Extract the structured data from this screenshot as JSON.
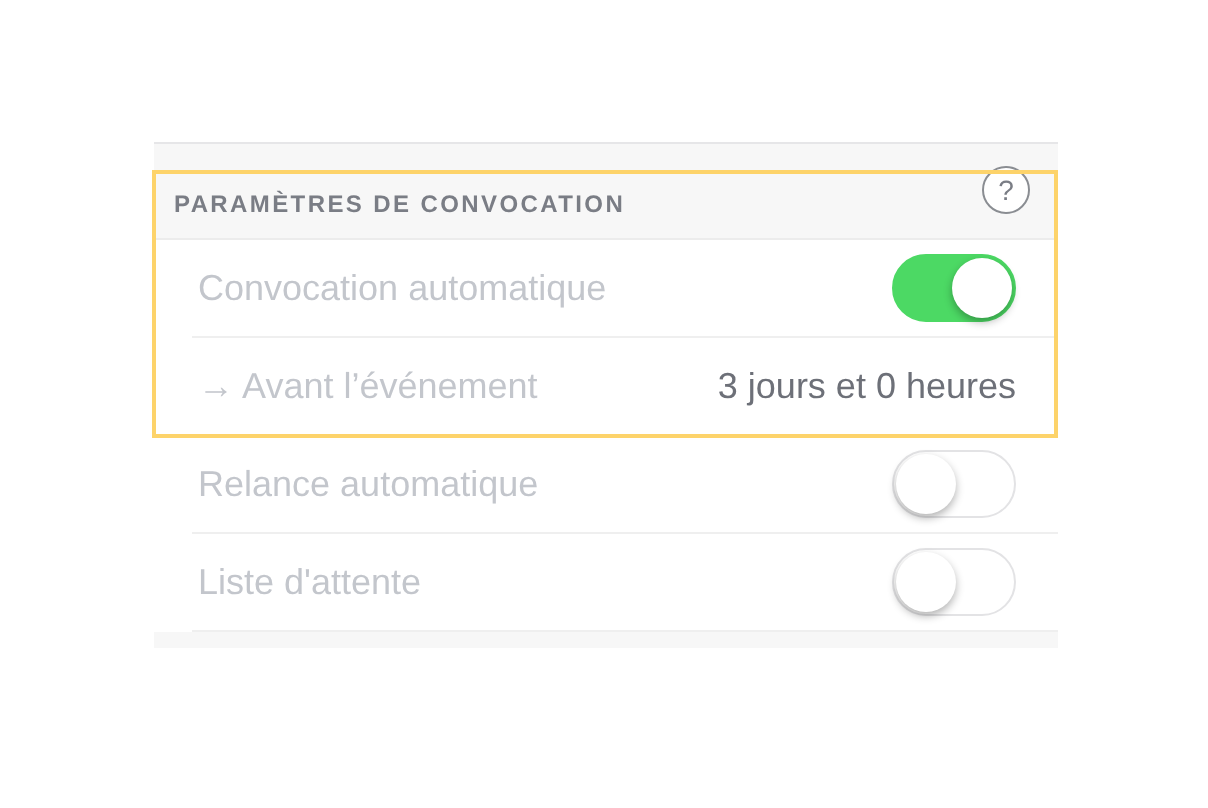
{
  "section": {
    "title": "PARAMÈTRES DE CONVOCATION",
    "help": "?",
    "highlighted": true
  },
  "rows": [
    {
      "kind": "toggle",
      "label": "Convocation automatique",
      "on": true
    },
    {
      "kind": "value",
      "label": "→ Avant l’événement",
      "value": "3 jours et 0 heures"
    },
    {
      "kind": "toggle",
      "label": "Relance automatique",
      "on": false
    },
    {
      "kind": "toggle",
      "label": "Liste d'attente",
      "on": false
    }
  ]
}
